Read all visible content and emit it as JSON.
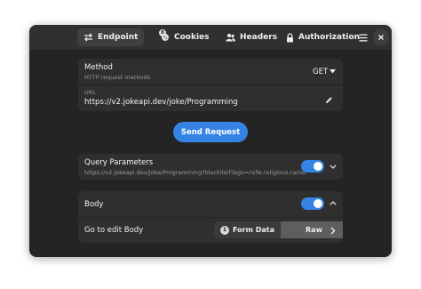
{
  "header": {
    "tabs": [
      {
        "label": "Endpoint",
        "icon": "swap-arrows-icon",
        "active": true
      },
      {
        "label": "Cookies",
        "icon": "cookie-icon",
        "badge": "8",
        "active": false
      },
      {
        "label": "Headers",
        "icon": "users-icon",
        "active": false
      },
      {
        "label": "Authorization",
        "icon": "lock-icon",
        "active": false
      }
    ],
    "menu_icon": "hamburger-menu-icon",
    "close_icon": "close-icon"
  },
  "endpoint": {
    "method_title": "Method",
    "method_subtitle": "HTTP request methods",
    "method_value": "GET",
    "url_label": "URL",
    "url_value": "https://v2.jokeapi.dev/joke/Programming"
  },
  "send_button": "Send Request",
  "query": {
    "title": "Query Parameters",
    "subtitle": "https://v2.jokeapi.dev/joke/Programming?blacklistFlags=nsfw,religious,racist",
    "enabled": true
  },
  "body": {
    "title": "Body",
    "enabled": true,
    "expanded": true,
    "edit_label": "Go to edit Body",
    "form_data_badge": "1",
    "form_data_label": "Form Data",
    "raw_label": "Raw",
    "selected": "Raw"
  },
  "colors": {
    "accent": "#3584e4",
    "window_bg": "#242424",
    "card_bg": "#2f2f2f"
  }
}
